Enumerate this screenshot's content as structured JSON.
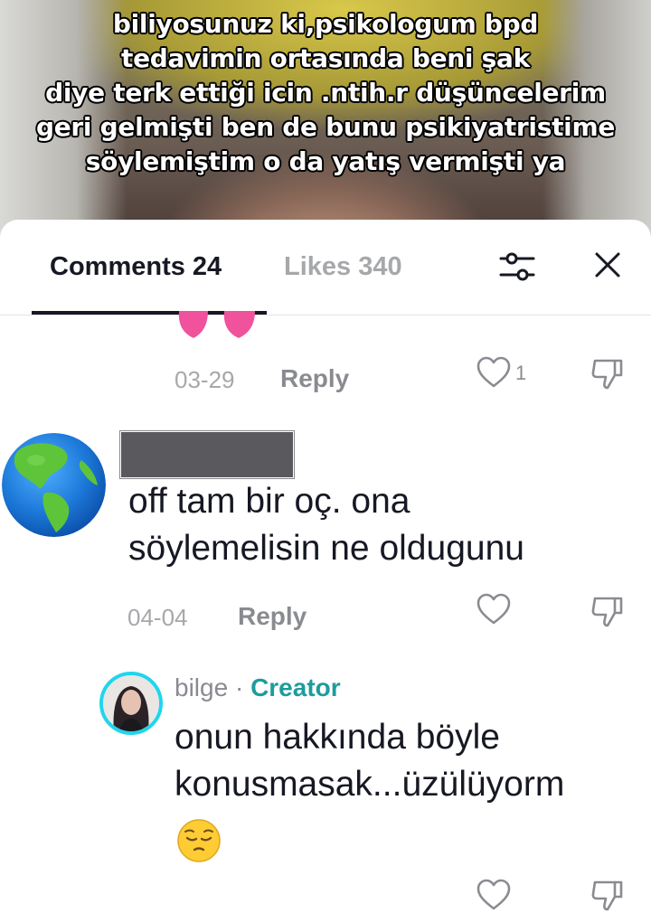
{
  "video": {
    "caption_lines": [
      "biliyosunuz ki,psikologum bpd",
      "tedavimin ortasında beni şak",
      "diye terk ettiği icin .ntih.r düşüncelerim",
      "geri gelmişti ben de bunu psikiyatristime",
      "söylemiştim o da yatış vermişti ya"
    ]
  },
  "tabs": {
    "comments_label": "Comments 24",
    "likes_label": "Likes 340"
  },
  "comments": [
    {
      "date": "03-29",
      "reply_label": "Reply",
      "like_count": "1"
    },
    {
      "text_lines": [
        "off tam bir oç. ona",
        "söylemelisin ne oldugunu"
      ],
      "date": "04-04",
      "reply_label": "Reply",
      "replies": [
        {
          "username": "bilge",
          "separator": " · ",
          "badge": "Creator",
          "text_lines": [
            "onun hakkında böyle",
            "konusmasak...üzülüyorm"
          ]
        }
      ]
    }
  ],
  "colors": {
    "accent_creator": "#1f9b9e",
    "avatar_ring": "#20d5ec",
    "muted_text": "#8a8b91",
    "primary_text": "#161823"
  },
  "icons": [
    "filter-icon",
    "close-icon",
    "heart-outline-icon",
    "dislike-icon",
    "globe-avatar",
    "pensive-emoji"
  ]
}
